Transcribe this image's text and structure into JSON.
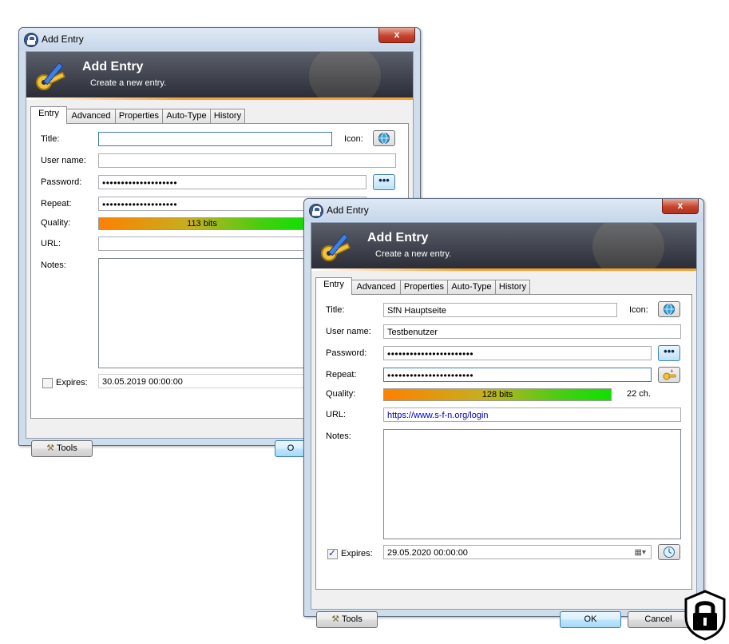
{
  "back_window": {
    "title": "Add Entry",
    "close": "x",
    "banner_title": "Add Entry",
    "banner_subtitle": "Create a new entry.",
    "tabs": [
      "Entry",
      "Advanced",
      "Properties",
      "Auto-Type",
      "History"
    ],
    "title_label": "Title:",
    "icon_label": "Icon:",
    "username_label": "User name:",
    "password_label": "Password:",
    "repeat_label": "Repeat:",
    "quality_label": "Quality:",
    "url_label": "URL:",
    "notes_label": "Notes:",
    "title_value": "",
    "username_value": "",
    "password_value": "••••••••••••••••••••",
    "repeat_value": "••••••••••••••••••••",
    "quality_text": "113 bits",
    "expires_label": "Expires:",
    "expires_value": "30.05.2019 00:00:00",
    "tools_label": "Tools",
    "ok_label": "O"
  },
  "front_window": {
    "title": "Add Entry",
    "close": "x",
    "banner_title": "Add Entry",
    "banner_subtitle": "Create a new entry.",
    "tabs": [
      "Entry",
      "Advanced",
      "Properties",
      "Auto-Type",
      "History"
    ],
    "title_label": "Title:",
    "icon_label": "Icon:",
    "username_label": "User name:",
    "password_label": "Password:",
    "repeat_label": "Repeat:",
    "quality_label": "Quality:",
    "url_label": "URL:",
    "notes_label": "Notes:",
    "title_value": "SfN Hauptseite",
    "username_value": "Testbenutzer",
    "password_value": "•••••••••••••••••••••••",
    "repeat_value": "•••••••••••••••••••••••",
    "quality_text": "128 bits",
    "quality_fraction": 0.8,
    "char_count": "22 ch.",
    "url_value": "https://www.s-f-n.org/login",
    "notes_value": "",
    "expires_checked": true,
    "expires_label": "Expires:",
    "expires_value": "29.05.2020 00:00:00",
    "tools_label": "Tools",
    "ok_label": "OK",
    "cancel_label": "Cancel"
  },
  "icons": [
    "lock-icon",
    "key-pen-icon",
    "globe-icon",
    "show-password-icon",
    "password-generator-icon",
    "calendar-icon",
    "clock-icon",
    "tools-icon",
    "lock-badge-icon"
  ],
  "colors": {
    "banner_dark": "#2a2d36",
    "banner_accent": "#f6a233",
    "url_text": "#0000cc"
  }
}
